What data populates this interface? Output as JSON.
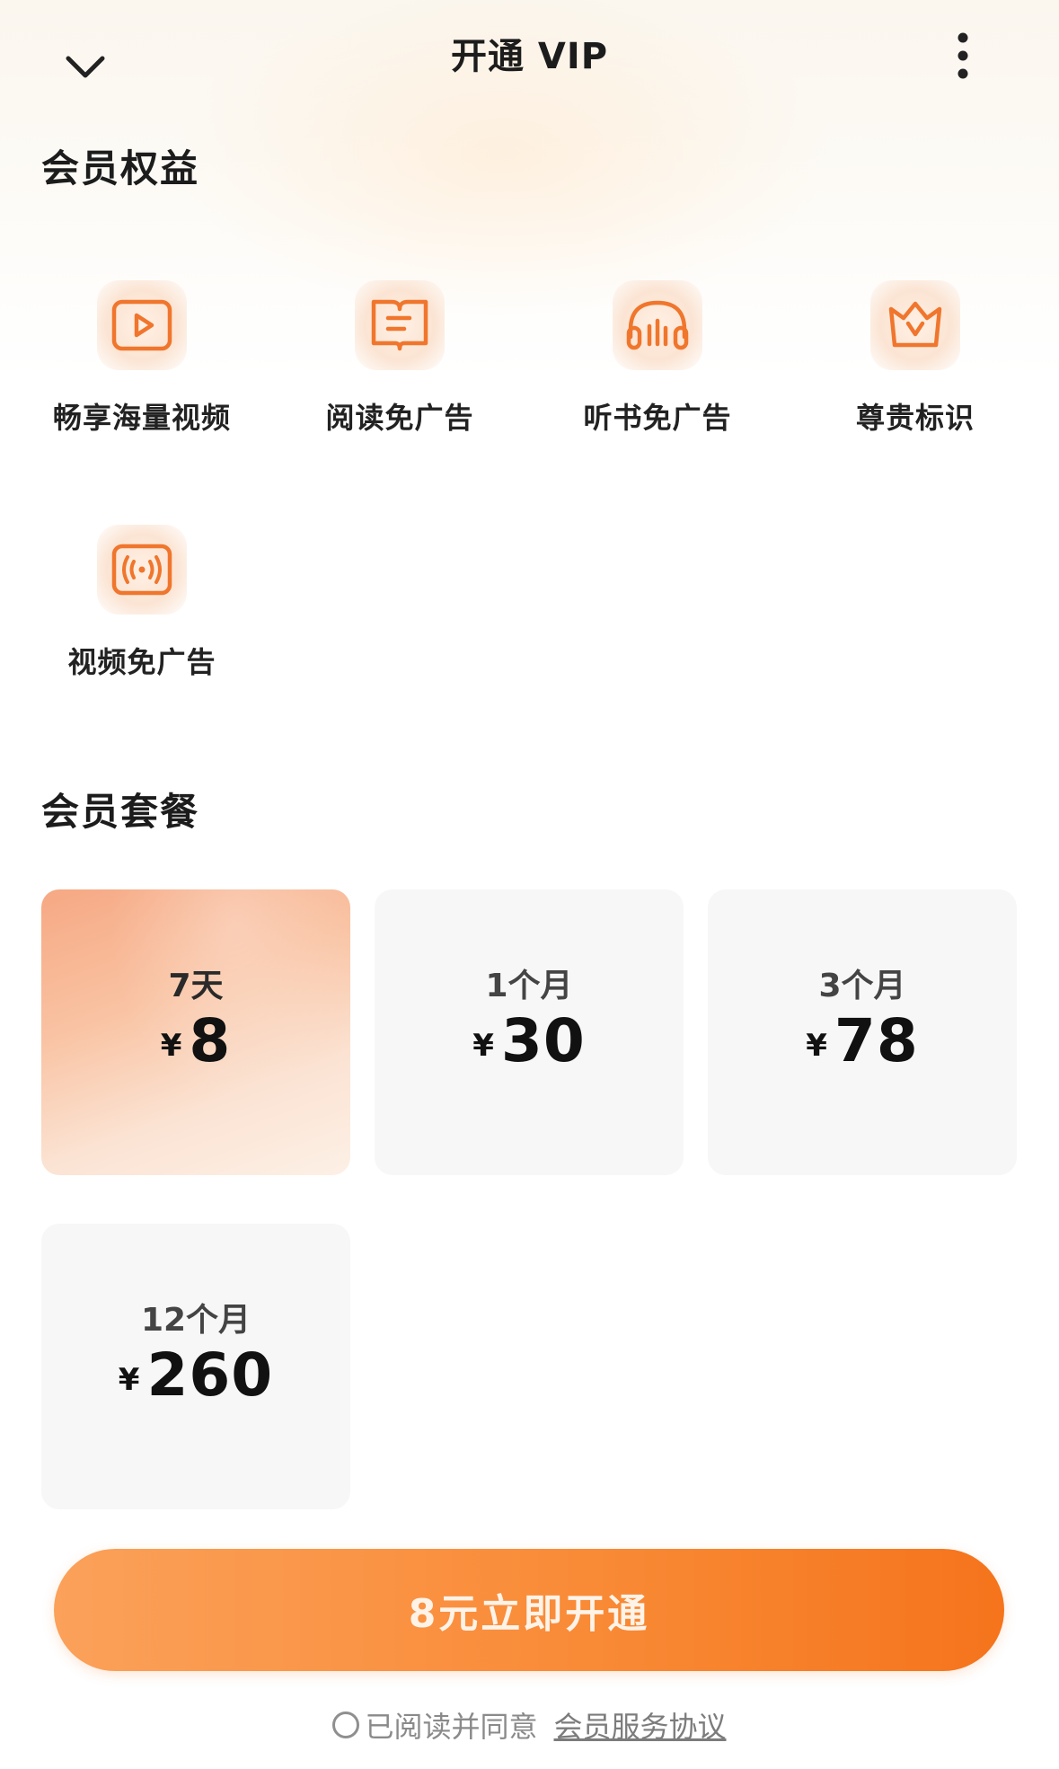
{
  "header": {
    "title": "开通 VIP",
    "back_icon": "chevron-down-icon",
    "more_icon": "more-vertical-icon"
  },
  "benefits": {
    "title": "会员权益",
    "items": [
      {
        "label": "畅享海量视频",
        "icon": "video-play-icon"
      },
      {
        "label": "阅读免广告",
        "icon": "book-icon"
      },
      {
        "label": "听书免广告",
        "icon": "headphones-icon"
      },
      {
        "label": "尊贵标识",
        "icon": "crown-icon"
      },
      {
        "label": "视频免广告",
        "icon": "broadcast-icon"
      }
    ]
  },
  "plans": {
    "title": "会员套餐",
    "items": [
      {
        "duration": "7天",
        "currency": "¥",
        "price": "8",
        "selected": true
      },
      {
        "duration": "1个月",
        "currency": "¥",
        "price": "30",
        "selected": false
      },
      {
        "duration": "3个月",
        "currency": "¥",
        "price": "78",
        "selected": false
      },
      {
        "duration": "12个月",
        "currency": "¥",
        "price": "260",
        "selected": false
      }
    ]
  },
  "cta": {
    "label": "8元立即开通"
  },
  "agreement": {
    "text": "已阅读并同意",
    "link": "会员服务协议",
    "checked": false
  },
  "colors": {
    "accent": "#f98b37",
    "icon_stroke": "#f0762d",
    "selected_plan": "#f9c3a3"
  }
}
